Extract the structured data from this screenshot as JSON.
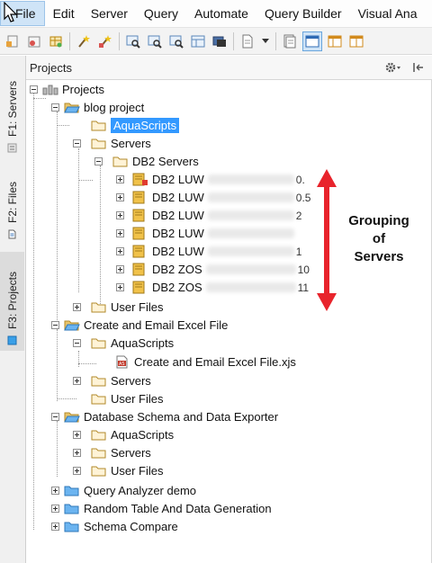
{
  "menu": [
    "File",
    "Edit",
    "Server",
    "Query",
    "Automate",
    "Query Builder",
    "Visual Ana"
  ],
  "panel": {
    "title": "Projects"
  },
  "side_tabs": [
    "F1: Servers",
    "F2: Files",
    "F3: Projects"
  ],
  "tree": {
    "root": "Projects",
    "blog_project": {
      "label": "blog project",
      "aquascripts": "AquaScripts",
      "servers": "Servers",
      "db2_servers": "DB2 Servers",
      "server_items": [
        {
          "label": "DB2 LUW",
          "tail": "0."
        },
        {
          "label": "DB2 LUW",
          "tail": "0.5"
        },
        {
          "label": "DB2 LUW",
          "tail": "2"
        },
        {
          "label": "DB2 LUW",
          "tail": ""
        },
        {
          "label": "DB2 LUW",
          "tail": "1"
        },
        {
          "label": "DB2 ZOS",
          "tail": "10"
        },
        {
          "label": "DB2 ZOS",
          "tail": "11"
        }
      ],
      "user_files": "User Files"
    },
    "excel_project": {
      "label": "Create and Email Excel File",
      "aquascripts": "AquaScripts",
      "script_file": "Create and Email Excel File.xjs",
      "servers": "Servers",
      "user_files": "User Files"
    },
    "schema_project": {
      "label": "Database Schema and Data Exporter",
      "aquascripts": "AquaScripts",
      "servers": "Servers",
      "user_files": "User Files"
    },
    "other_projects": [
      "Query Analyzer demo",
      "Random Table And Data Generation",
      "Schema Compare"
    ]
  },
  "annotation": {
    "line1": "Grouping",
    "line2": "of",
    "line3": "Servers"
  },
  "colors": {
    "arrow": "#e8242c",
    "selection": "#3399ff",
    "folder": "#e8c46b"
  }
}
